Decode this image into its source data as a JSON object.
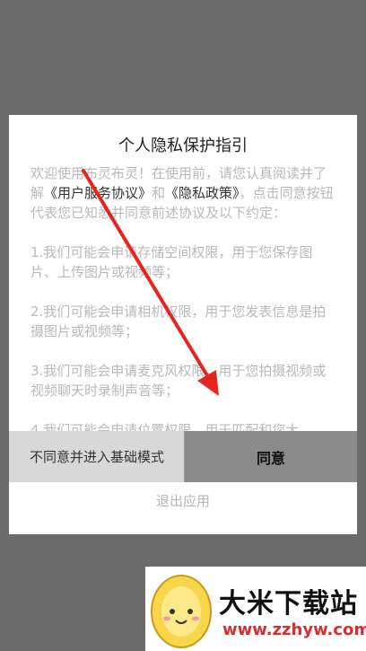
{
  "dialog": {
    "title": "个人隐私保护指引",
    "intro_before": "欢迎使用布灵布灵！在使用前，请您认真阅读并了解",
    "link_agreement": "《用户服务协议》",
    "intro_and": "和",
    "link_privacy": "《隐私政策》",
    "intro_after": "，点击同意按钮代表您已知悉并同意前述协议及以下约定：",
    "items": [
      "1.我们可能会申请存储空间权限，用于您保存图片、上传图片或视频等；",
      "2.我们可能会申请相机权限，用于您发表信息是拍摄图片或视频等；",
      "3.我们可能会申请麦克风权限，用于您拍摄视频或视频聊天时录制声音等；",
      "4.我们可能会申请位置权限，用于匹配和您大"
    ],
    "disagree_label": "不同意并进入基础模式",
    "agree_label": "同意",
    "exit_label": "退出应用"
  },
  "watermark": {
    "name": "大米下载站",
    "url": "www.zzhyw.com"
  },
  "colors": {
    "overlay": "#6b6b6b",
    "arrow": "#e5261f",
    "agree_bg": "#8a8a8a",
    "disagree_bg": "#d8d8d8"
  }
}
